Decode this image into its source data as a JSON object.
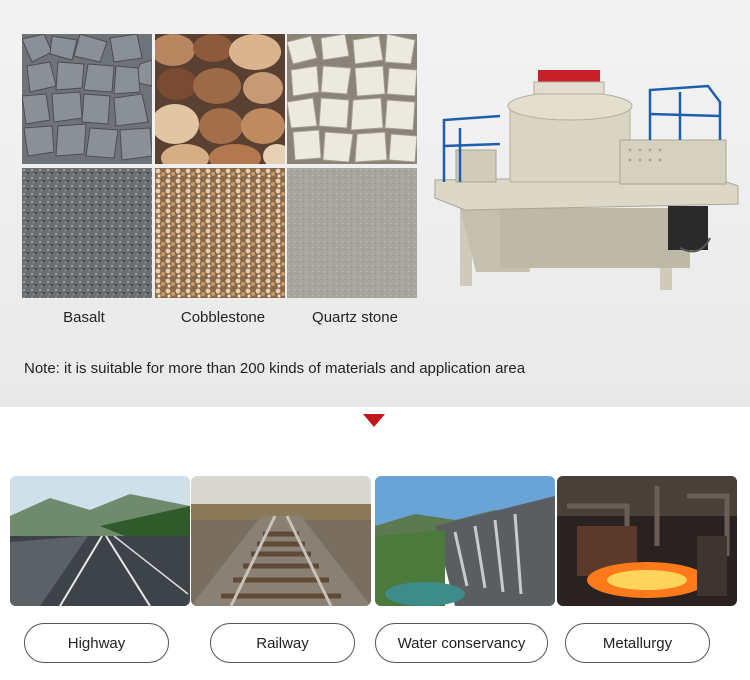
{
  "materials": [
    {
      "label": "Basalt"
    },
    {
      "label": "Cobblestone"
    },
    {
      "label": "Quartz stone"
    }
  ],
  "note": "Note: it is suitable for more than 200 kinds of materials and application area",
  "applications": [
    {
      "label": "Highway"
    },
    {
      "label": "Railway"
    },
    {
      "label": "Water conservancy"
    },
    {
      "label": "Metallurgy"
    }
  ],
  "colors": {
    "accent_arrow": "#c0161c",
    "machine_body": "#d9d5c4",
    "machine_top": "#c8202a",
    "machine_rail": "#1b5fae"
  }
}
